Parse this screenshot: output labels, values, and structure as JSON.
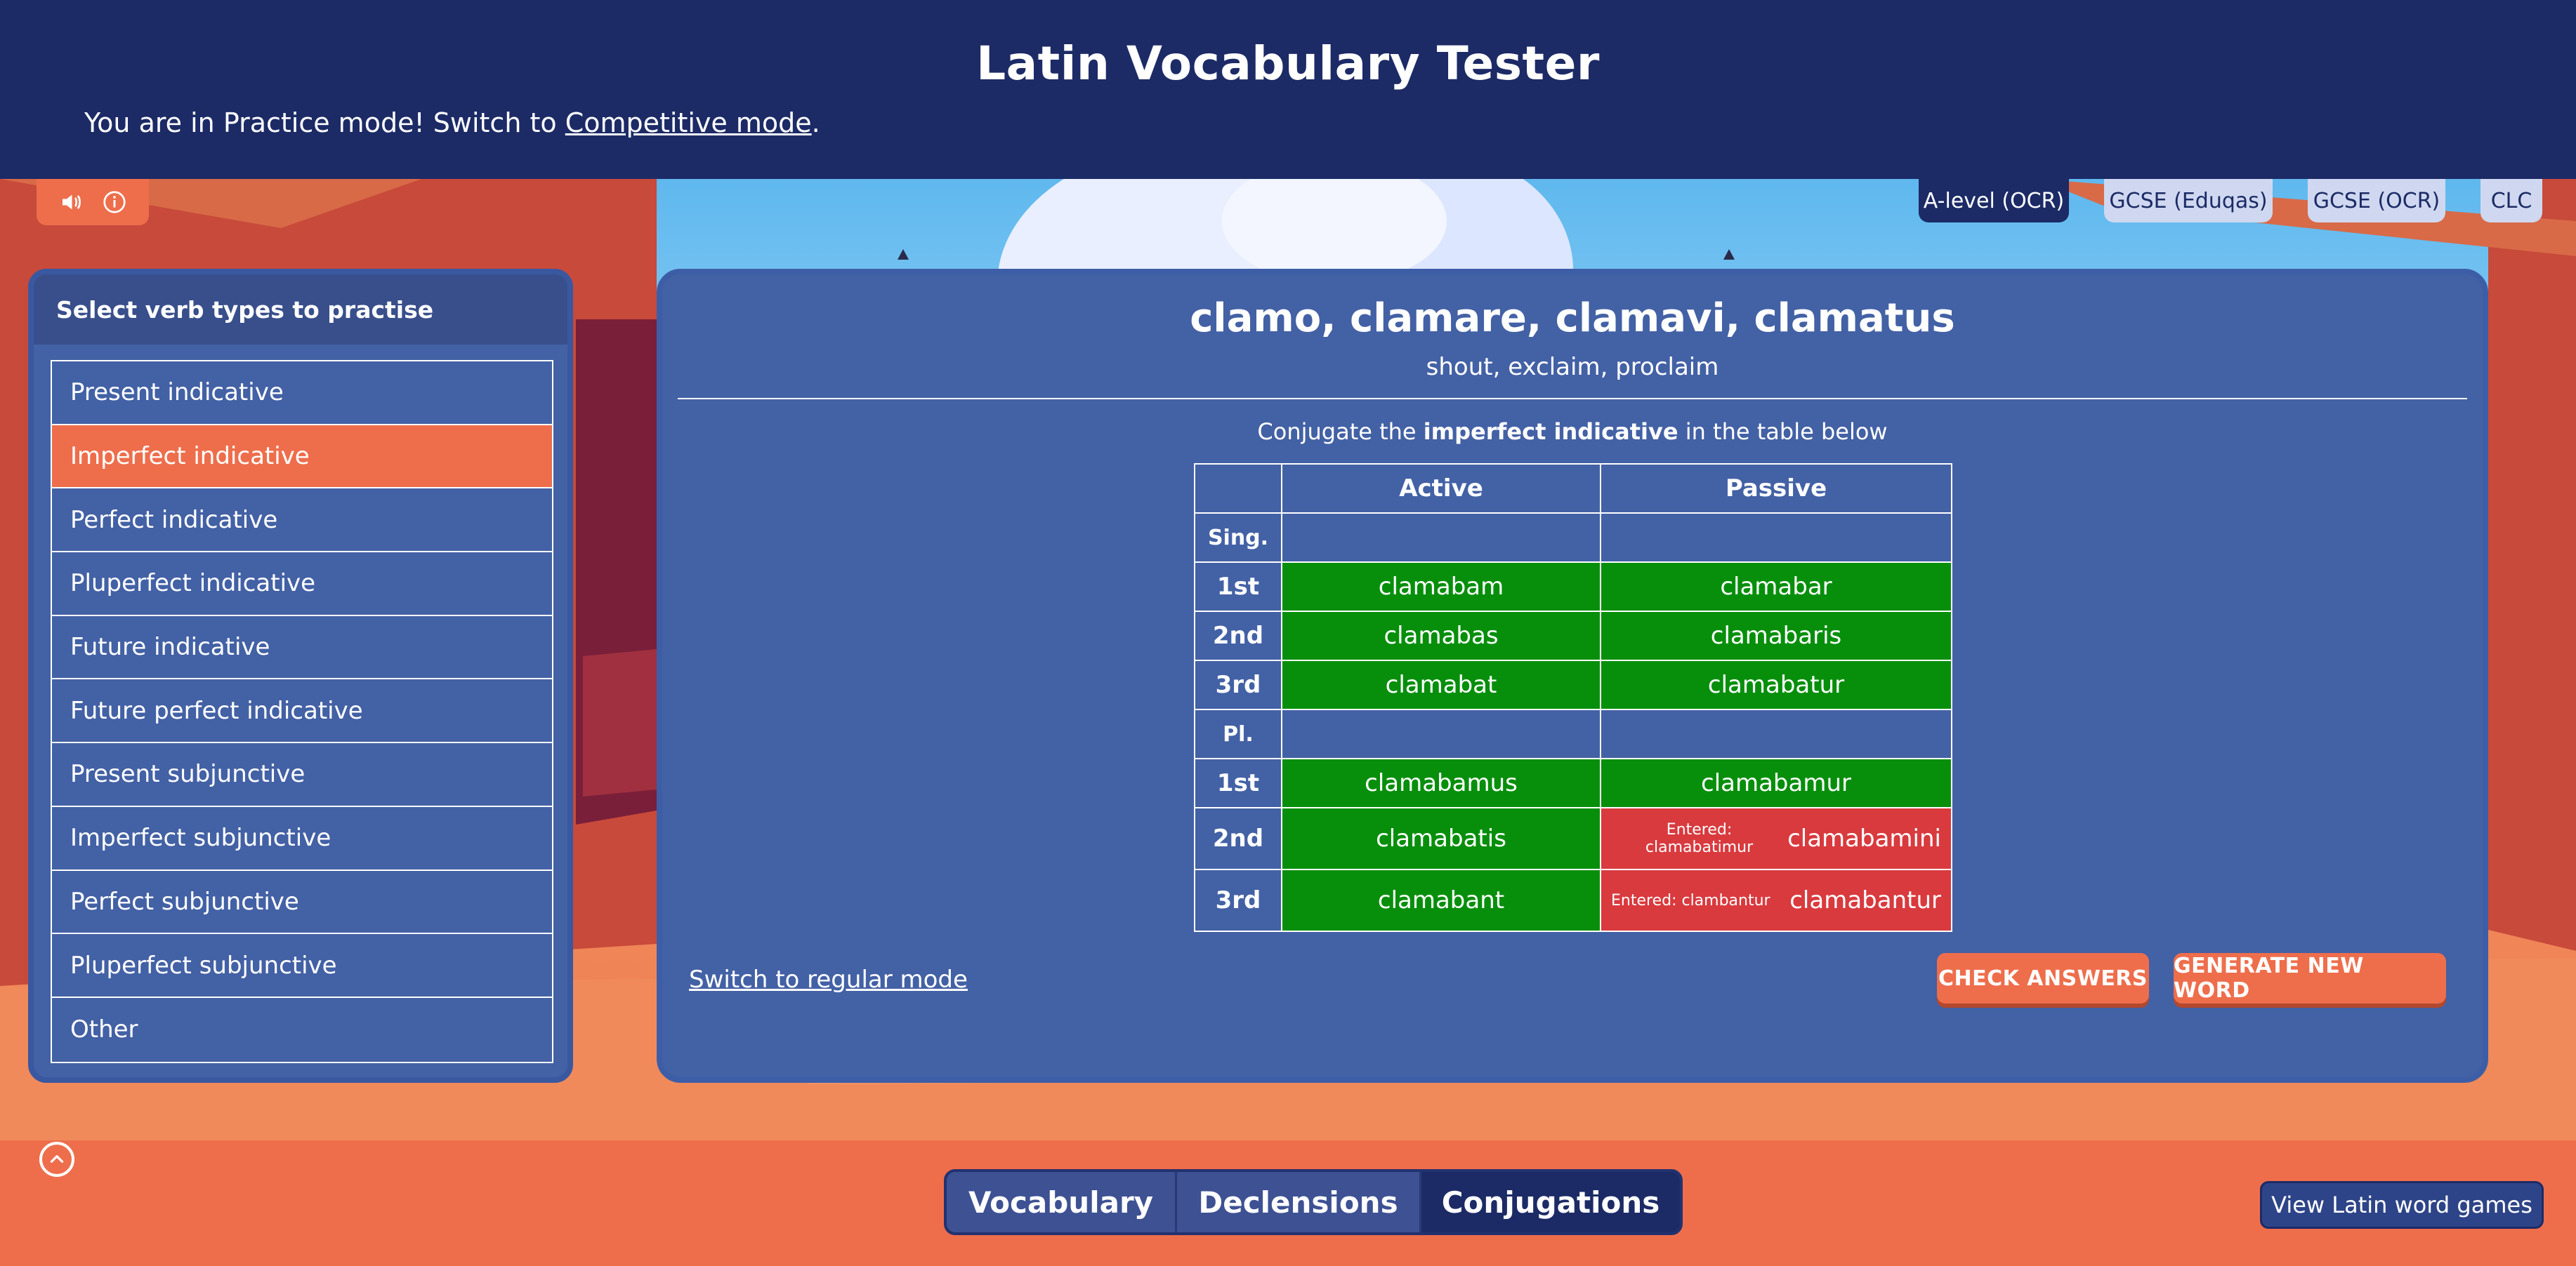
{
  "header": {
    "title": "Latin Vocabulary Tester",
    "mode_prefix": "You are in Practice mode! Switch to ",
    "mode_link": "Competitive mode",
    "mode_suffix": "."
  },
  "utility": {
    "sound_icon": "speaker-icon",
    "info_icon": "info-icon"
  },
  "courses": [
    {
      "label": "A-level (OCR)",
      "active": true
    },
    {
      "label": "GCSE (Eduqas)",
      "active": false
    },
    {
      "label": "GCSE (OCR)",
      "active": false
    },
    {
      "label": "CLC",
      "active": false
    }
  ],
  "sidebar": {
    "heading": "Select verb types to practise",
    "items": [
      {
        "label": "Present indicative"
      },
      {
        "label": "Imperfect indicative",
        "selected": true
      },
      {
        "label": "Perfect indicative"
      },
      {
        "label": "Pluperfect indicative"
      },
      {
        "label": "Future indicative"
      },
      {
        "label": "Future perfect indicative"
      },
      {
        "label": "Present subjunctive"
      },
      {
        "label": "Imperfect subjunctive"
      },
      {
        "label": "Perfect subjunctive"
      },
      {
        "label": "Pluperfect subjunctive"
      },
      {
        "label": "Other"
      }
    ]
  },
  "word": {
    "principal_parts": "clamo, clamare, clamavi, clamatus",
    "meaning": "shout, exclaim, proclaim",
    "instruction_prefix": "Conjugate the ",
    "instruction_tense": "imperfect indicative",
    "instruction_suffix": " in the table below"
  },
  "table": {
    "col_active": "Active",
    "col_passive": "Passive",
    "sing_label": "Sing.",
    "pl_label": "Pl.",
    "rows": [
      {
        "person": "1st",
        "active": "clamabam",
        "passive": "clamabar"
      },
      {
        "person": "2nd",
        "active": "clamabas",
        "passive": "clamabaris"
      },
      {
        "person": "3rd",
        "active": "clamabat",
        "passive": "clamabatur"
      },
      {
        "person": "1st",
        "active": "clamabamus",
        "passive": "clamabamur"
      },
      {
        "person": "2nd",
        "active": "clamabatis",
        "passive": "clamabamini",
        "passive_entered": "Entered: clamabatimur"
      },
      {
        "person": "3rd",
        "active": "clamabant",
        "passive": "clamabantur",
        "passive_entered": "Entered: clambantur"
      }
    ]
  },
  "actions": {
    "switch_link": "Switch to regular mode",
    "check": "CHECK ANSWERS",
    "generate": "GENERATE NEW WORD"
  },
  "footer": {
    "nav": [
      "Vocabulary",
      "Declensions",
      "Conjugations"
    ],
    "nav_active": "Conjugations",
    "games_button": "View Latin word games"
  },
  "colors": {
    "header": "#1c2b66",
    "panel": "#4361a5",
    "accent": "#ee6e4c",
    "correct": "#078f0c",
    "incorrect": "#d93a3e"
  }
}
